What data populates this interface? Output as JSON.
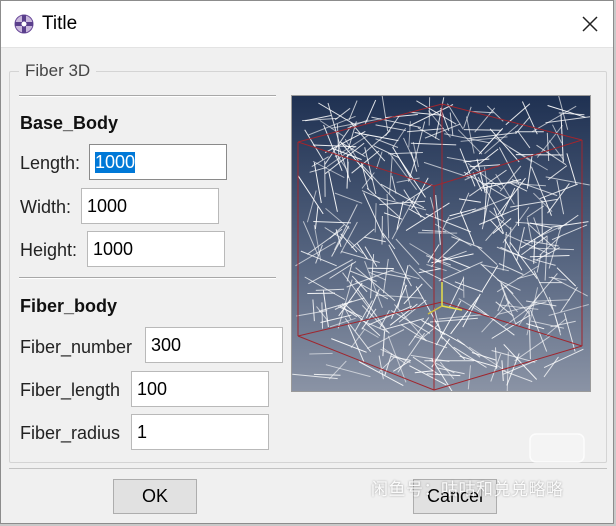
{
  "window": {
    "title": "Title",
    "app_icon": "abaqus-cross-icon",
    "close_icon": "close-icon"
  },
  "group": {
    "legend": "Fiber 3D"
  },
  "base_body": {
    "heading": "Base_Body",
    "length_label": "Length:",
    "length_value": "1000",
    "width_label": "Width:",
    "width_value": "1000",
    "height_label": "Height:",
    "height_value": "1000"
  },
  "fiber_body": {
    "heading": "Fiber_body",
    "number_label": "Fiber_number",
    "number_value": "300",
    "length_label": "Fiber_length",
    "length_value": "100",
    "radius_label": "Fiber_radius",
    "radius_value": "1"
  },
  "preview": {
    "description_icon": "fiber-cube-preview-image",
    "fiber_color": "#ffffff",
    "cube_edge_color": "#a0262e"
  },
  "buttons": {
    "ok_label": "OK",
    "cancel_label": "Cancel"
  },
  "watermark": {
    "text": "闲鱼号：咕咕和兑兑略略",
    "logo_text": "闲鱼"
  },
  "colors": {
    "selection": "#0078d7",
    "dialog_bg": "#f0f0f0"
  }
}
